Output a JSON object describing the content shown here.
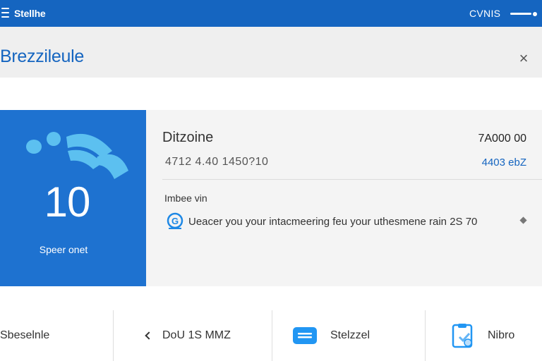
{
  "topbar": {
    "title": "Stellhe",
    "right_label": "CVNIS",
    "menu_icon": "hamburger-icon"
  },
  "header": {
    "title": "Brezzileule",
    "close_icon": "close-icon",
    "close_glyph": "×"
  },
  "tile": {
    "number": "10",
    "caption": "Speer onet",
    "logo_icon": "signal-wave-icon"
  },
  "item": {
    "title": "Ditzoine",
    "amount": "7A000 00",
    "sub": "4712 4.40  1450?10",
    "sub_right": "4403 ebZ",
    "section_label": "Imbee vin",
    "info_text": "Ueacer you your intacmeering feu your uthesmene rain 2S 70",
    "info_icon": "g-circle-icon"
  },
  "bottom_nav": {
    "item1": "Sbeselnle",
    "item2": "DoU 1S MMZ",
    "item3": "Stelzzel",
    "item4": "Nibro"
  },
  "colors": {
    "primary": "#1565c0",
    "tile": "#1e72d0",
    "accent": "#5cc0f0"
  }
}
